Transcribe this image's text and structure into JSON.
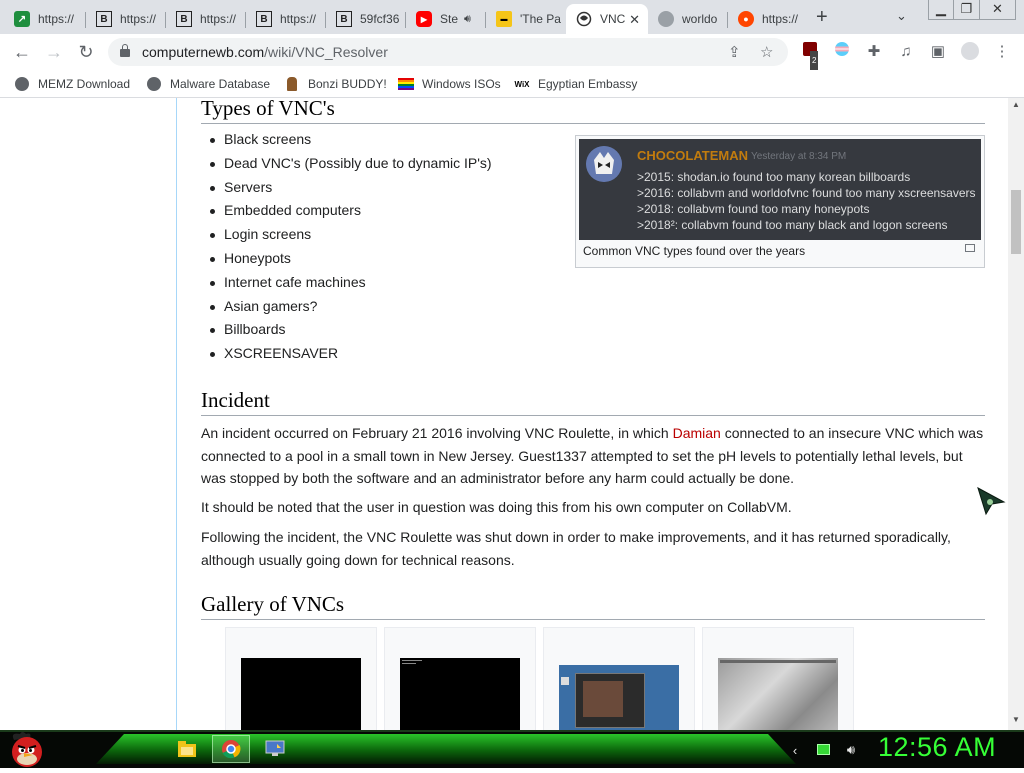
{
  "browser": {
    "tabs": [
      {
        "title": "https://",
        "icon": "green-arrow-icon"
      },
      {
        "title": "https://",
        "icon": "b-icon"
      },
      {
        "title": "https://",
        "icon": "b-icon"
      },
      {
        "title": "https://",
        "icon": "b-icon"
      },
      {
        "title": "59fcf36",
        "icon": "b-icon"
      },
      {
        "title": "Ste",
        "icon": "youtube-icon",
        "audio": true
      },
      {
        "title": "'The Pa",
        "icon": "imdb-icon"
      },
      {
        "title": "VNC",
        "icon": "wiki-icon",
        "active": true
      },
      {
        "title": "worldo",
        "icon": "globe-icon"
      },
      {
        "title": "https://",
        "icon": "reddit-icon"
      }
    ],
    "new_tab_label": "+",
    "url_host": "computernewb.com",
    "url_path": "/wiki/VNC_Resolver",
    "extension_badge": "2",
    "window_controls": {
      "minimize": "▁",
      "restore": "❐",
      "close": "✕"
    }
  },
  "bookmarks": [
    {
      "label": "MEMZ Download",
      "icon": "globe-icon"
    },
    {
      "label": "Malware Database",
      "icon": "globe-icon"
    },
    {
      "label": "Bonzi BUDDY!",
      "icon": "bonzi-icon"
    },
    {
      "label": "Windows ISOs",
      "icon": "rainbow-flag-icon"
    },
    {
      "label": "Egyptian Embassy",
      "icon": "wix-icon"
    }
  ],
  "page": {
    "section_types_heading": "Types of VNC's",
    "vnc_types": [
      "Black screens",
      "Dead VNC's (Possibly due to dynamic IP's)",
      "Servers",
      "Embedded computers",
      "Login screens",
      "Honeypots",
      "Internet cafe machines",
      "Asian gamers?",
      "Billboards",
      "XSCREENSAVER"
    ],
    "thumbnail": {
      "username": "CHOCOLATEMAN",
      "timestamp": "Yesterday at 8:34 PM",
      "lines": [
        ">2015: shodan.io found too many korean billboards",
        ">2016: collabvm and worldofvnc found too many xscreensavers",
        ">2018: collabvm found too many honeypots",
        ">2018²: collabvm found too many black and logon screens"
      ],
      "caption": "Common VNC types found over the years"
    },
    "section_incident_heading": "Incident",
    "incident_p1_before": "An incident occurred on February 21 2016 involving VNC Roulette, in which ",
    "incident_p1_link": "Damian",
    "incident_p1_after": " connected to an insecure VNC which was connected to a pool in a small town in New Jersey. Guest1337 attempted to set the pH levels to potentially lethal levels, but was stopped by both the software and an administrator before any harm could actually be done.",
    "incident_p2": "It should be noted that the user in question was doing this from his own computer on CollabVM.",
    "incident_p3": "Following the incident, the VNC Roulette was shut down in order to make improvements, and it has returned sporadically, although usually going down for technical reasons.",
    "section_gallery_heading": "Gallery of VNCs"
  },
  "taskbar": {
    "clock": "12:56 AM",
    "apps": [
      {
        "name": "file-explorer-icon",
        "active": false
      },
      {
        "name": "chrome-icon",
        "active": true
      },
      {
        "name": "display-settings-icon",
        "active": false
      }
    ]
  },
  "colors": {
    "link_red": "#ba0000",
    "clock_green": "#36ff36",
    "taskbar_glow": "#2ccf2c"
  }
}
